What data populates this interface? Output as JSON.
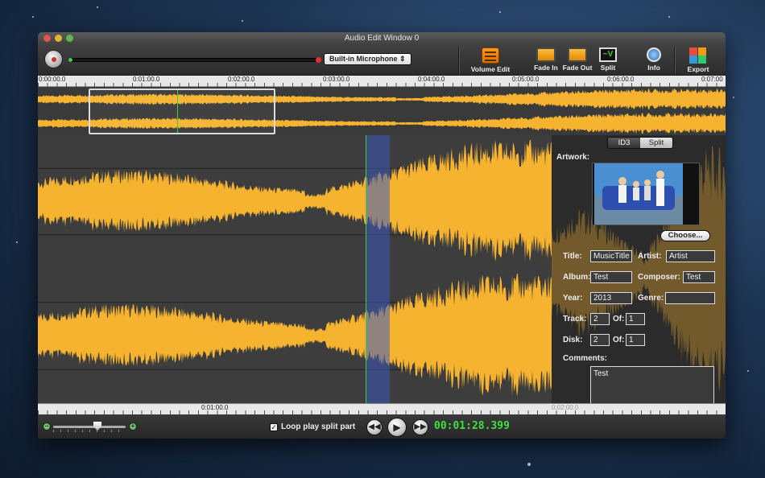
{
  "window": {
    "title": "Audio Edit Window 0"
  },
  "toolbar": {
    "input_device": "Built-in Microphone ⇕",
    "tools": [
      {
        "label": "Volume Edit",
        "icon": "volume-edit-icon"
      },
      {
        "label": "Fade In",
        "icon": "fade-in-icon"
      },
      {
        "label": "Fade Out",
        "icon": "fade-out-icon"
      },
      {
        "label": "Split",
        "icon": "split-icon"
      },
      {
        "label": "Info",
        "icon": "info-icon"
      },
      {
        "label": "Export",
        "icon": "export-icon"
      }
    ]
  },
  "ruler": {
    "ticks": [
      "0:00:00.0",
      "0:01:00.0",
      "0:02:00.0",
      "0:03:00.0",
      "0:04:00.0",
      "0:05:00.0",
      "0:06:00.0",
      "0:07:00"
    ]
  },
  "bottom_ruler": {
    "ticks": [
      "0:01:00.0",
      "0:02:00.0"
    ]
  },
  "footer": {
    "loop_checked": true,
    "loop_label": "Loop play split part",
    "rewind_icon": "rewind-icon",
    "play_icon": "play-icon",
    "forward_icon": "fast-forward-icon",
    "time": "00:01:28.399"
  },
  "panel": {
    "tabs": [
      "ID3",
      "Split"
    ],
    "active_tab": "ID3",
    "artwork_label": "Artwork:",
    "choose_label": "Choose...",
    "fields": {
      "title_label": "Title:",
      "title_value": "MusicTitle",
      "artist_label": "Artist:",
      "artist_value": "Artist",
      "album_label": "Album:",
      "album_value": "Test",
      "composer_label": "Composer:",
      "composer_value": "Test",
      "year_label": "Year:",
      "year_value": "2013",
      "genre_label": "Genre:",
      "genre_value": "",
      "track_label": "Track:",
      "track_value": "2",
      "track_of_label": "Of:",
      "track_of_value": "1",
      "disk_label": "Disk:",
      "disk_value": "2",
      "disk_of_label": "Of:",
      "disk_of_value": "1",
      "comments_label": "Comments:",
      "comments_value": "Test"
    }
  },
  "colors": {
    "waveform": "#f6b330",
    "cursor": "#3bd13b",
    "selection": "#3c5abe",
    "time": "#3fe03f"
  }
}
